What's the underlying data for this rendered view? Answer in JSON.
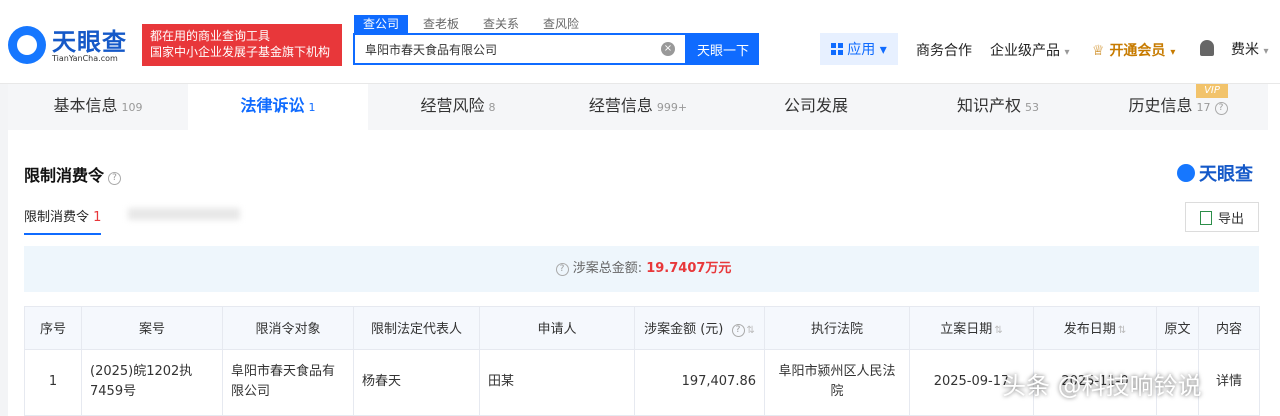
{
  "header": {
    "brand_cn": "天眼查",
    "brand_en": "TianYanCha.com",
    "promo_line1": "都在用的商业查询工具",
    "promo_line2": "国家中小企业发展子基金旗下机构",
    "search_tabs": [
      "查公司",
      "查老板",
      "查关系",
      "查风险"
    ],
    "search_value": "阜阳市春天食品有限公司",
    "search_button": "天眼一下",
    "apps_label": "应用",
    "nav": {
      "business": "商务合作",
      "enterprise": "企业级产品",
      "vip": "开通会员",
      "user": "费米"
    }
  },
  "main_tabs": [
    {
      "label": "基本信息",
      "count": "109"
    },
    {
      "label": "法律诉讼",
      "count": "1"
    },
    {
      "label": "经营风险",
      "count": "8"
    },
    {
      "label": "经营信息",
      "count": "999+"
    },
    {
      "label": "公司发展",
      "count": ""
    },
    {
      "label": "知识产权",
      "count": "53"
    },
    {
      "label": "历史信息",
      "count": "17"
    }
  ],
  "vip_badge": "VIP",
  "section": {
    "title": "限制消费令",
    "brand_right": "天眼查",
    "subtab_label": "限制消费令",
    "subtab_count": "1",
    "export": "导出",
    "summary_label": "涉案总金额:",
    "summary_amount": "19.7407万元"
  },
  "table": {
    "headers": [
      "序号",
      "案号",
      "限消令对象",
      "限制法定代表人",
      "申请人",
      "涉案金额 (元)",
      "执行法院",
      "立案日期",
      "发布日期",
      "原文",
      "内容"
    ],
    "rows": [
      {
        "index": "1",
        "case_no": "(2025)皖1202执7459号",
        "target": "阜阳市春天食品有限公司",
        "legal_rep": "杨春天",
        "applicant": "田某",
        "amount": "197,407.86",
        "court": "阜阳市颍州区人民法院",
        "filed_date": "2025-09-17",
        "publish_date": "2025-11-0",
        "original": "",
        "content": "详情"
      }
    ]
  },
  "watermark": "头条 @科技响铃说"
}
